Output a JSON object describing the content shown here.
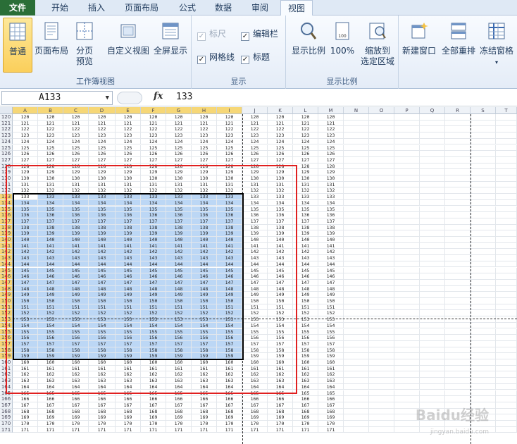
{
  "tabs": [
    "文件",
    "开始",
    "插入",
    "页面布局",
    "公式",
    "数据",
    "审阅",
    "视图"
  ],
  "active_tab": "视图",
  "groups": {
    "workbook_views": {
      "label": "工作簿视图",
      "buttons": [
        "普通",
        "页面布局",
        "分页\n预览",
        "自定义视图",
        "全屏显示"
      ]
    },
    "show": {
      "label": "显示",
      "checkboxes": [
        {
          "label": "标尺",
          "checked": true,
          "disabled": true
        },
        {
          "label": "编辑栏",
          "checked": true,
          "disabled": false
        },
        {
          "label": "网格线",
          "checked": true,
          "disabled": false
        },
        {
          "label": "标题",
          "checked": true,
          "disabled": false
        }
      ]
    },
    "zoom": {
      "label": "显示比例",
      "buttons": [
        "显示比例",
        "100%",
        "缩放到\n选定区域"
      ]
    },
    "window": {
      "buttons": [
        "新建窗口",
        "全部重排",
        "冻结窗格"
      ]
    }
  },
  "formula_bar": {
    "name_box": "A133",
    "fx": "fx",
    "value": "133"
  },
  "columns": [
    "A",
    "B",
    "C",
    "D",
    "E",
    "F",
    "G",
    "H",
    "I",
    "J",
    "K",
    "L",
    "M",
    "N",
    "O",
    "P",
    "Q",
    "R",
    "S",
    "T"
  ],
  "selected_columns": [
    "A",
    "B",
    "C",
    "D",
    "E",
    "F",
    "G",
    "H",
    "I"
  ],
  "rows_start": 120,
  "rows_end": 171,
  "selection": {
    "from_row": 133,
    "to_row": 159,
    "from_col": "A",
    "to_col": "I"
  },
  "active_cell": "A133",
  "watermark": "Baidu经验",
  "watermark_sub": "jingyan.baidu.com"
}
